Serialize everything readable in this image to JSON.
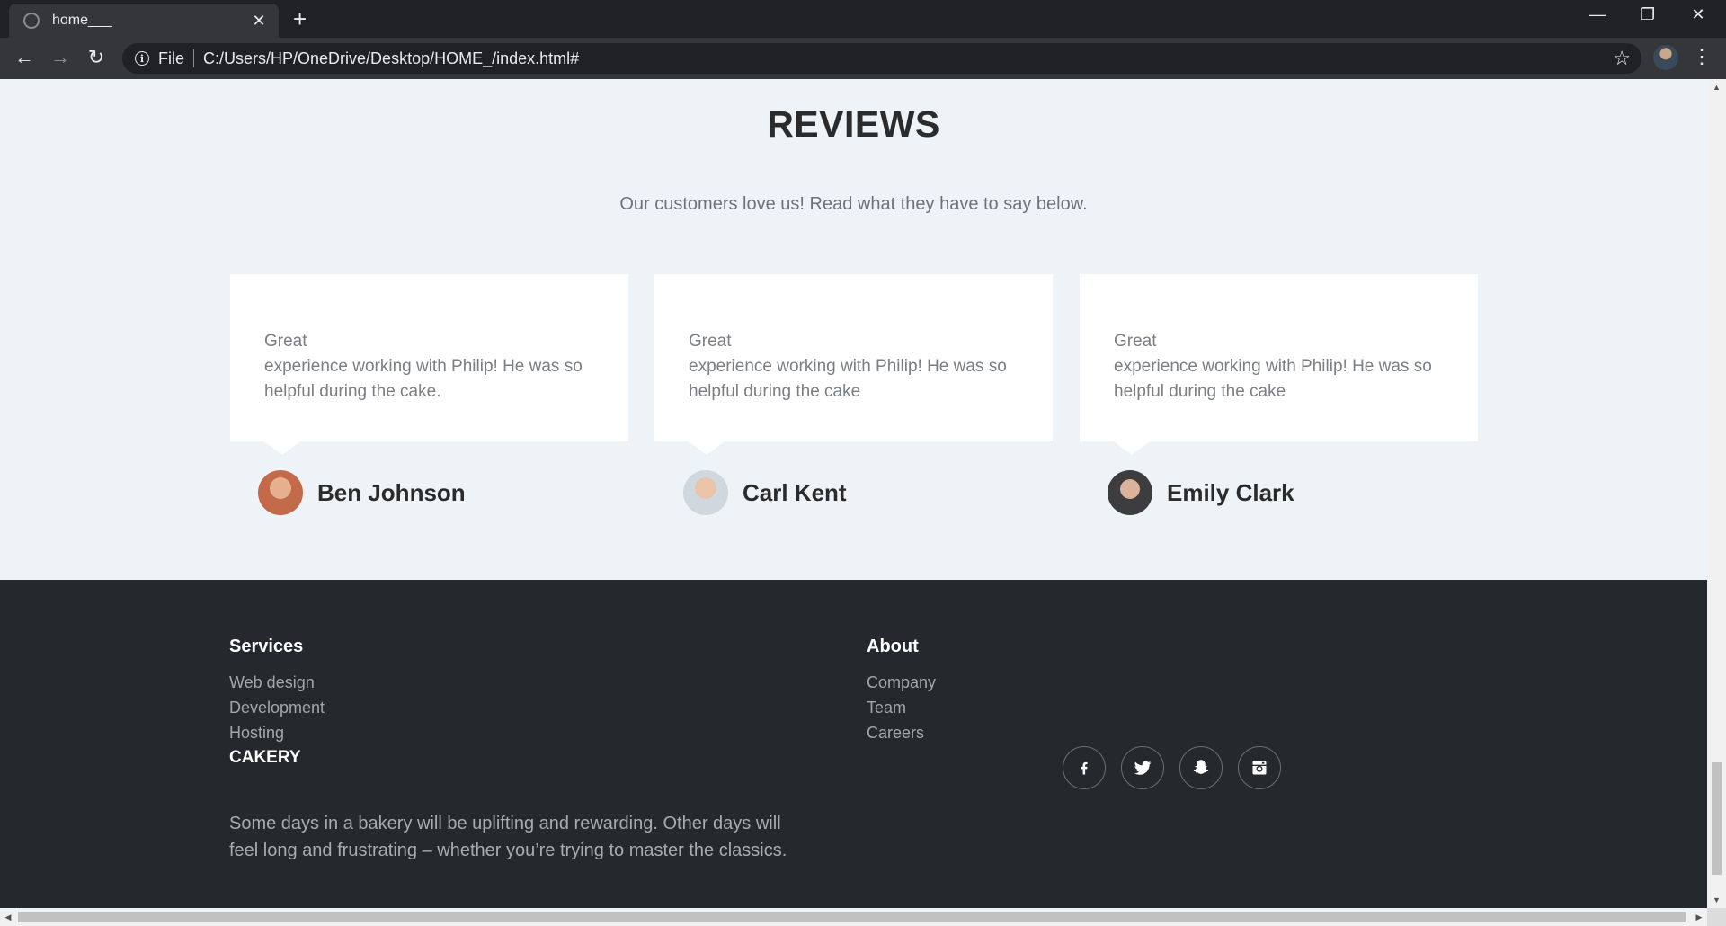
{
  "browser": {
    "tab_title": "home___",
    "tab_close": "✕",
    "new_tab": "+",
    "file_label": "File",
    "url": "C:/Users/HP/OneDrive/Desktop/HOME_/index.html#",
    "minimize": "—",
    "restore": "❐",
    "close": "✕",
    "back": "←",
    "forward": "→",
    "reload": "↻",
    "info": "i",
    "star": "☆",
    "menu": "⋮"
  },
  "reviews": {
    "title": "REVIEWS",
    "subtitle": "Our customers love us! Read what they have to say below.",
    "items": [
      {
        "line1": "Great",
        "line2": "experience working with Philip! He was so",
        "line3": "helpful during the cake.",
        "name": "Ben Johnson",
        "avatar_color": "#c26a4a"
      },
      {
        "line1": "Great",
        "line2": "experience working with Philip! He was so",
        "line3": "helpful during the cake",
        "name": "Carl Kent",
        "avatar_color": "#7a6a5e"
      },
      {
        "line1": "Great",
        "line2": "experience working with Philip! He was so",
        "line3": "helpful during the cake",
        "name": "Emily Clark",
        "avatar_color": "#3d3d3f"
      }
    ]
  },
  "footer": {
    "services": {
      "heading": "Services",
      "links": [
        "Web design",
        "Development",
        "Hosting"
      ]
    },
    "about": {
      "heading": "About",
      "links": [
        "Company",
        "Team",
        "Careers"
      ]
    },
    "brand": "CAKERY",
    "brand_text_line1": "Some days in a bakery will be uplifting and rewarding. Other days will",
    "brand_text_line2": "feel long and frustrating – whether you’re trying to master the classics.",
    "social": [
      "facebook-icon",
      "twitter-icon",
      "snapchat-icon",
      "instagram-icon"
    ]
  },
  "colors": {
    "page_bg": "#eef3f7",
    "footer_bg": "#25292d",
    "card_bg": "#ffffff"
  }
}
